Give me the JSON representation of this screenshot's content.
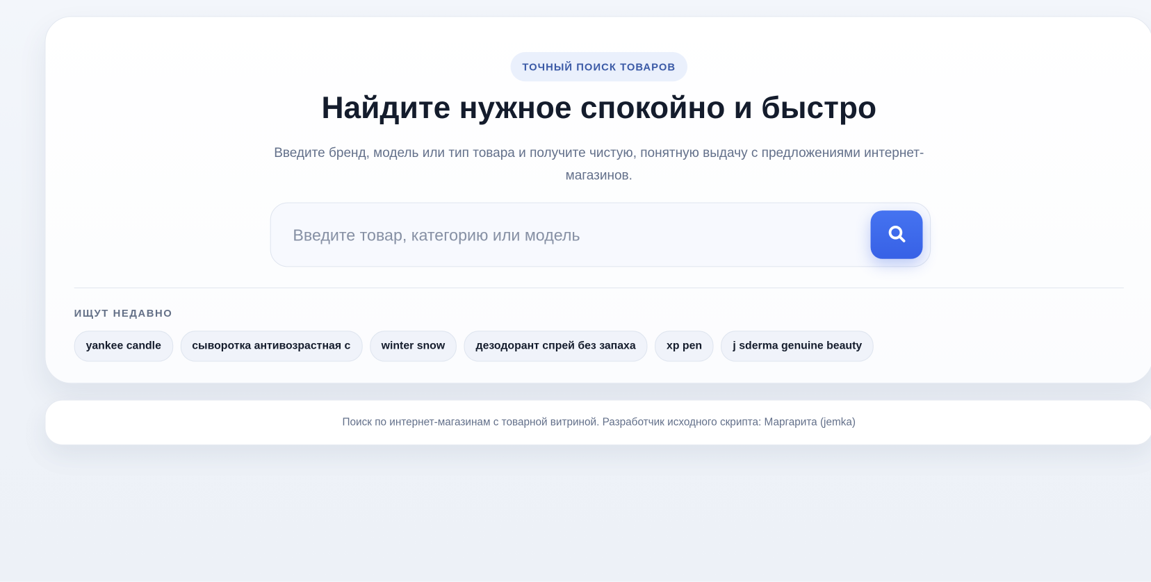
{
  "hero": {
    "badge": "ТОЧНЫЙ ПОИСК ТОВАРОВ",
    "title": "Найдите нужное спокойно и быстро",
    "subtitle": "Введите бренд, модель или тип товара и получите чистую, понятную выдачу с предложениями интернет-магазинов."
  },
  "search": {
    "value": "",
    "placeholder": "Введите товар, категорию или модель",
    "button_icon": "search-icon",
    "accent": "#3d68eb"
  },
  "recent": {
    "label": "ИЩУТ НЕДАВНО",
    "items": [
      "yankee candle",
      "сыворотка антивозрастная с",
      "winter snow",
      "дезодорант спрей без запаха",
      "xp pen",
      "j sderma genuine beauty"
    ]
  },
  "footer": {
    "text": "Поиск по интернет-магазинам с товарной витриной. Разработчик исходного скрипта: Маргарита (jemka)"
  }
}
